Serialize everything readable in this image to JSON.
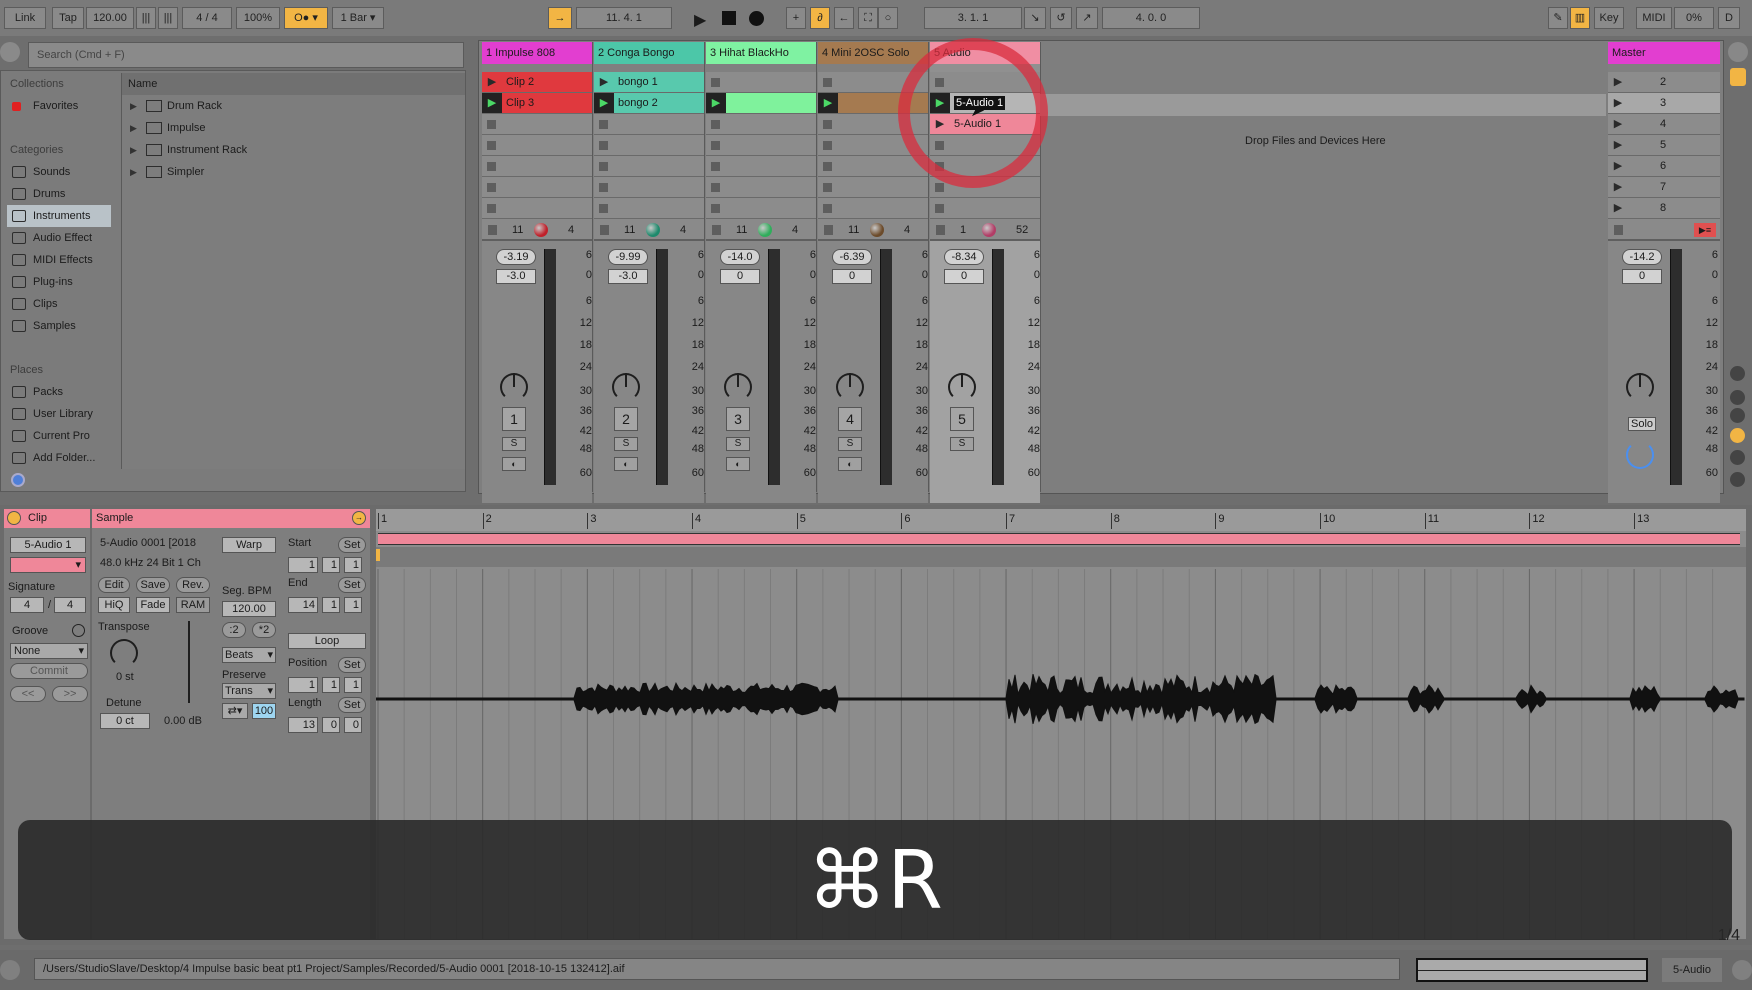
{
  "toolbar": {
    "link": "Link",
    "tap": "Tap",
    "tempo": "120.00",
    "signature": "4 / 4",
    "zoom": "100%",
    "quantize": "1 Bar",
    "position": "11.  4.  1",
    "loop_start": "3.  1.  1",
    "loop_length": "4.  0.  0",
    "key": "Key",
    "midi": "MIDI",
    "cpu": "0%",
    "d": "D"
  },
  "browser": {
    "search_placeholder": "Search (Cmd + F)",
    "collections_label": "Collections",
    "favorites": "Favorites",
    "categories_label": "Categories",
    "categories": [
      "Sounds",
      "Drums",
      "Instruments",
      "Audio Effect",
      "MIDI Effects",
      "Plug-ins",
      "Clips",
      "Samples"
    ],
    "selected_category": "Instruments",
    "places_label": "Places",
    "places": [
      "Packs",
      "User Library",
      "Current Pro",
      "Add Folder..."
    ],
    "name_header": "Name",
    "items": [
      "Drum Rack",
      "Impulse",
      "Instrument Rack",
      "Simpler"
    ]
  },
  "tracks": [
    {
      "name": "1 Impulse 808",
      "color": "#e23ed0",
      "clips": [
        {
          "label": "Clip 2",
          "color": "#e0393e"
        },
        {
          "label": "Clip 3",
          "color": "#e0393e",
          "playing": true
        }
      ],
      "in": "11",
      "out": "4",
      "orb": "#c0202a",
      "volume": "-3.19",
      "pan": "-3.0",
      "num": "1"
    },
    {
      "name": "2 Conga Bongo",
      "color": "#4cc7a8",
      "clips": [
        {
          "label": "bongo 1",
          "color": "#58c9ad"
        },
        {
          "label": "bongo 2",
          "color": "#58c9ad",
          "playing": true
        }
      ],
      "in": "11",
      "out": "4",
      "orb": "#1d8a6c",
      "volume": "-9.99",
      "pan": "-3.0",
      "num": "2"
    },
    {
      "name": "3 Hihat BlackHo",
      "color": "#7ff2a2",
      "clips": [
        null,
        {
          "label": "",
          "color": "#7ff29c",
          "playing": true
        }
      ],
      "in": "11",
      "out": "4",
      "orb": "#2fae5b",
      "volume": "-14.0",
      "pan": "0",
      "num": "3"
    },
    {
      "name": "4 Mini 2OSC Solo",
      "color": "#a57a50",
      "clips": [
        null,
        {
          "label": "",
          "color": "#a57a50",
          "playing": true
        }
      ],
      "in": "11",
      "out": "4",
      "orb": "#6c4b2a",
      "volume": "-6.39",
      "pan": "0",
      "num": "4"
    },
    {
      "name": "5 Audio",
      "color": "#f08ea3",
      "clips": [
        null,
        {
          "label": "5-Audio 1",
          "color": "#e8e8e8",
          "playing": true,
          "editing": true
        },
        {
          "label": "5-Audio 1",
          "color": "#ef8799"
        }
      ],
      "in": "1",
      "out": "52",
      "orb": "#b23c66",
      "volume": "-8.34",
      "pan": "0",
      "num": "5",
      "selected": true
    }
  ],
  "meter_scale": [
    "6",
    "0",
    "6",
    "12",
    "18",
    "24",
    "30",
    "36",
    "42",
    "48",
    "60"
  ],
  "drop_hint": "Drop Files and Devices Here",
  "master": {
    "name": "Master",
    "color": "#e23ed0",
    "scenes": [
      "2",
      "3",
      "4",
      "5",
      "6",
      "7",
      "8"
    ],
    "volume": "-14.2",
    "pan": "0",
    "solo": "Solo"
  },
  "clip_panel": {
    "title": "Clip",
    "name": "5-Audio 1",
    "signature_label": "Signature",
    "sig_num": "4",
    "sig_den": "4",
    "groove_label": "Groove",
    "groove": "None",
    "commit": "Commit",
    "prev": "<<",
    "next": ">>"
  },
  "sample_panel": {
    "title": "Sample",
    "file": "5-Audio 0001 [2018",
    "format": "48.0 kHz 24 Bit 1 Ch",
    "edit": "Edit",
    "save": "Save",
    "rev": "Rev.",
    "hiq": "HiQ",
    "fade": "Fade",
    "ram": "RAM",
    "transpose_label": "Transpose",
    "transpose": "0 st",
    "detune_label": "Detune",
    "detune": "0 ct",
    "gain": "0.00 dB",
    "warp": "Warp",
    "seg_bpm_label": "Seg. BPM",
    "seg_bpm": "120.00",
    "half": ":2",
    "double": "*2",
    "warp_mode": "Beats",
    "preserve_label": "Preserve",
    "preserve": "Trans",
    "envelope": "100",
    "start_label": "Start",
    "end_label": "End",
    "set": "Set",
    "start": [
      "1",
      "1",
      "1"
    ],
    "end": [
      "14",
      "1",
      "1"
    ],
    "loop": "Loop",
    "position_label": "Position",
    "position": [
      "1",
      "1",
      "1"
    ],
    "length_label": "Length",
    "length": [
      "13",
      "0",
      "0"
    ]
  },
  "ruler": [
    "1",
    "2",
    "3",
    "4",
    "5",
    "6",
    "7",
    "8",
    "9",
    "10",
    "11",
    "12",
    "13"
  ],
  "zoom_readout": "1/4",
  "overlay": {
    "shortcut": "⌘R"
  },
  "status": {
    "path": "/Users/StudioSlave/Desktop/4 Impulse basic beat pt1 Project/Samples/Recorded/5-Audio 0001 [2018-10-15 132412].aif",
    "track": "5-Audio"
  },
  "colors": {
    "accent": "#f2b544",
    "clip_pink": "#ef8799",
    "annotation_ring": "#d92c3d"
  }
}
